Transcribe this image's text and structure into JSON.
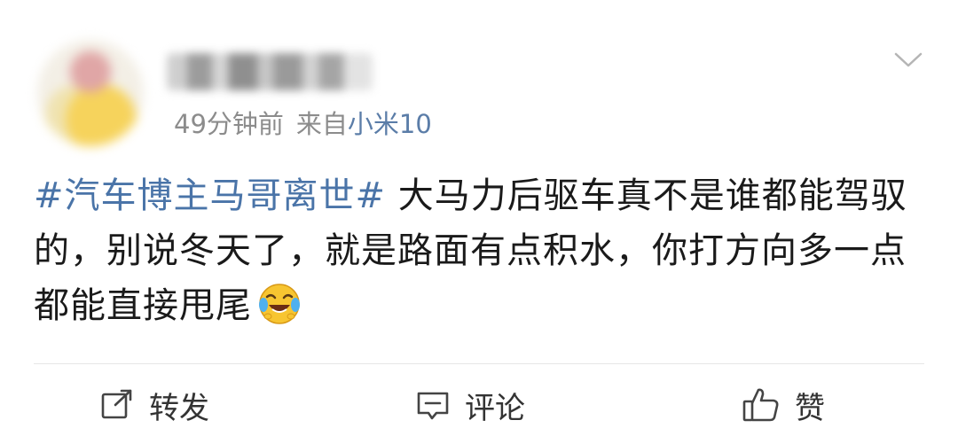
{
  "post": {
    "time": "49分钟前",
    "source_prefix": "来自",
    "source_device": "小米10",
    "hashtag": "#汽车博主马哥离世#",
    "text": " 大马力后驱车真不是谁都能驾驭的，别说冬天了，就是路面有点积水，你打方向多一点都能直接甩尾",
    "emoji": "laughing-crying-emoji"
  },
  "actions": {
    "repost_label": "转发",
    "comment_label": "评论",
    "like_label": "赞"
  },
  "colors": {
    "hashtag": "#4a74a8",
    "meta": "#8c8c8c",
    "text": "#1a1a1a"
  }
}
